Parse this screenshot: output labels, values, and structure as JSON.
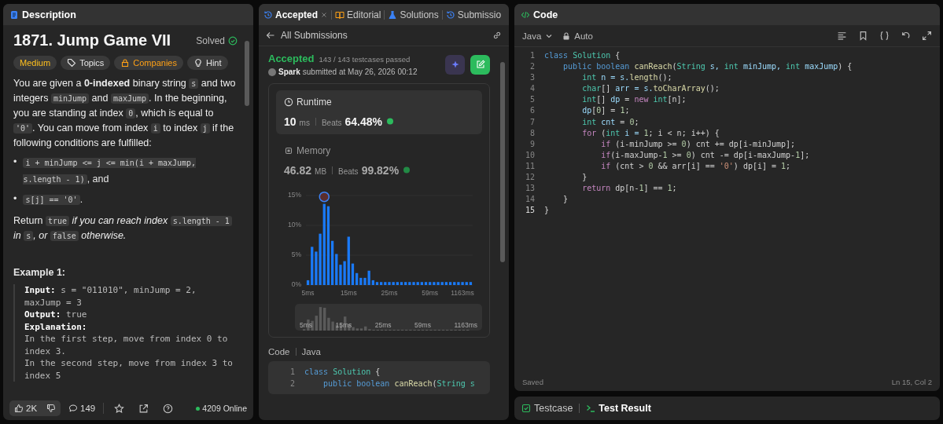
{
  "description_panel": {
    "tab": "Description",
    "title": "1871. Jump Game VII",
    "status": "Solved",
    "tags": [
      {
        "label": "Medium",
        "kind": "difficulty"
      },
      {
        "label": "Topics",
        "kind": "topics"
      },
      {
        "label": "Companies",
        "kind": "companies"
      },
      {
        "label": "Hint",
        "kind": "hint"
      }
    ],
    "paragraph_1": [
      {
        "text": "You are given a ",
        "kind": "text"
      },
      {
        "text": "0-indexed",
        "kind": "bold"
      },
      {
        "text": " binary string ",
        "kind": "text"
      },
      {
        "text": "s",
        "kind": "code"
      },
      {
        "text": " and two integers ",
        "kind": "text"
      },
      {
        "text": "minJump",
        "kind": "code"
      },
      {
        "text": " and ",
        "kind": "text"
      },
      {
        "text": "maxJump",
        "kind": "code"
      },
      {
        "text": ". In the beginning, you are standing at index ",
        "kind": "text"
      },
      {
        "text": "0",
        "kind": "code"
      },
      {
        "text": ", which is equal to ",
        "kind": "text"
      },
      {
        "text": "'0'",
        "kind": "code"
      },
      {
        "text": ". You can move from index ",
        "kind": "text"
      },
      {
        "text": "i",
        "kind": "code"
      },
      {
        "text": " to index ",
        "kind": "text"
      },
      {
        "text": "j",
        "kind": "code"
      },
      {
        "text": " if the following conditions are fulfilled:",
        "kind": "text"
      }
    ],
    "bullets": [
      {
        "marker": "•",
        "segments": [
          {
            "text": "i + minJump <= j <= min(i + maxJump, s.length - 1)",
            "kind": "code"
          },
          {
            "text": ", and",
            "kind": "text"
          }
        ]
      },
      {
        "marker": "•",
        "segments": [
          {
            "text": "s[j] == '0'",
            "kind": "code"
          },
          {
            "text": ".",
            "kind": "text"
          }
        ]
      }
    ],
    "paragraph_2": [
      {
        "text": "Return ",
        "kind": "text"
      },
      {
        "text": "true",
        "kind": "code"
      },
      {
        "text": " if you can reach index ",
        "kind": "italic"
      },
      {
        "text": "s.length - 1",
        "kind": "code"
      },
      {
        "text": " in ",
        "kind": "italic"
      },
      {
        "text": "s",
        "kind": "code"
      },
      {
        "text": ", or ",
        "kind": "italic"
      },
      {
        "text": "false",
        "kind": "code"
      },
      {
        "text": " otherwise.",
        "kind": "italic"
      }
    ],
    "example_title": "Example 1:",
    "example_lines": [
      {
        "label": "Input:",
        "value": " s = \"011010\", minJump = 2,"
      },
      {
        "value": "maxJump = 3"
      },
      {
        "label": "Output:",
        "value": " true"
      },
      {
        "label": "Explanation:"
      },
      {
        "value": "In the first step, move from index 0 to"
      },
      {
        "value": "index 3."
      },
      {
        "value": "In the second step, move from index 3 to"
      },
      {
        "value": "index 5"
      }
    ],
    "footer": {
      "likes": "2K",
      "comments": "149",
      "online": "4209 Online"
    }
  },
  "submission_panel": {
    "tabs": [
      {
        "label": "Accepted",
        "kind": "accepted",
        "selected": true
      },
      {
        "label": "Editorial",
        "kind": "editorial",
        "selected": false
      },
      {
        "label": "Solutions",
        "kind": "solutions",
        "selected": false
      },
      {
        "label": "Submissio",
        "kind": "submissions",
        "selected": false
      }
    ],
    "back_link": "All Submissions",
    "result": "Accepted",
    "testcases": "143 / 143 testcases passed",
    "user": "Spark",
    "submitted": "submitted at May 26, 2026 00:12",
    "runtime": {
      "title": "Runtime",
      "value": "10",
      "unit": "ms",
      "beats_label": "Beats",
      "beats": "64.48%"
    },
    "memory": {
      "title": "Memory",
      "value": "46.82",
      "unit": "MB",
      "beats_label": "Beats",
      "beats": "99.82%"
    },
    "chart_data": {
      "type": "bar",
      "ylim": [
        0,
        15
      ],
      "yticks": [
        {
          "value": 0,
          "label": "0%"
        },
        {
          "value": 5,
          "label": "5%"
        },
        {
          "value": 10,
          "label": "10%"
        },
        {
          "value": 15,
          "label": "15%"
        }
      ],
      "categories": [
        "5ms",
        null,
        null,
        null,
        null,
        null,
        null,
        null,
        null,
        null,
        "15ms",
        null,
        null,
        null,
        null,
        null,
        null,
        null,
        null,
        null,
        "25ms",
        null,
        null,
        null,
        null,
        null,
        null,
        null,
        null,
        null,
        "59ms",
        null,
        null,
        null,
        null,
        null,
        null,
        null,
        "1163ms",
        null,
        null
      ],
      "values": [
        0.8,
        6.4,
        5.6,
        8.6,
        13.6,
        13.2,
        7.4,
        5.2,
        3.4,
        4.0,
        8.1,
        3.6,
        2.0,
        1.2,
        1.2,
        2.4,
        0.8,
        0.5,
        0.5,
        0.5,
        0.5,
        0.5,
        0.5,
        0.5,
        0.5,
        0.5,
        0.5,
        0.5,
        0.5,
        0.5,
        0.5,
        0.5,
        0.5,
        0.5,
        0.5,
        0.5,
        0.5,
        0.5,
        0.5,
        0.5,
        0.5
      ]
    },
    "overview_labels": [
      "5ms",
      "15ms",
      "25ms",
      "59ms",
      "1163ms"
    ],
    "code_title": "Code",
    "code_language": "Java",
    "code_lines": [
      {
        "n": "1",
        "tokens": [
          {
            "text": "class ",
            "kind": "decl"
          },
          {
            "text": "Solution",
            "kind": "type"
          },
          {
            "text": " {",
            "kind": "p"
          }
        ]
      },
      {
        "n": "2",
        "tokens": [
          {
            "text": "    public boolean ",
            "kind": "decl"
          },
          {
            "text": "canReach",
            "kind": "fn"
          },
          {
            "text": "(",
            "kind": "p"
          },
          {
            "text": "String s",
            "kind": "type"
          }
        ]
      }
    ]
  },
  "code_panel": {
    "title": "Code",
    "language": "Java",
    "mode": "Auto",
    "lines": [
      {
        "n": "1",
        "tokens": [
          {
            "text": "class ",
            "kind": "decl"
          },
          {
            "text": "Solution",
            "kind": "type"
          },
          {
            "text": " {",
            "kind": "p"
          }
        ]
      },
      {
        "n": "2",
        "tokens": [
          {
            "text": "    public boolean ",
            "kind": "decl"
          },
          {
            "text": "canReach",
            "kind": "fn"
          },
          {
            "text": "(",
            "kind": "p"
          },
          {
            "text": "String",
            "kind": "type"
          },
          {
            "text": " s, ",
            "kind": "var"
          },
          {
            "text": "int",
            "kind": "type"
          },
          {
            "text": " minJump, ",
            "kind": "var"
          },
          {
            "text": "int",
            "kind": "type"
          },
          {
            "text": " maxJump",
            "kind": "var"
          },
          {
            "text": ") {",
            "kind": "p"
          }
        ]
      },
      {
        "n": "3",
        "tokens": [
          {
            "text": "        int",
            "kind": "type"
          },
          {
            "text": " n = s.",
            "kind": "var"
          },
          {
            "text": "length",
            "kind": "fn"
          },
          {
            "text": "();",
            "kind": "p"
          }
        ]
      },
      {
        "n": "4",
        "tokens": [
          {
            "text": "        char",
            "kind": "type"
          },
          {
            "text": "[] ",
            "kind": "p"
          },
          {
            "text": "arr",
            "kind": "var"
          },
          {
            "text": " = s.",
            "kind": "var"
          },
          {
            "text": "toCharArray",
            "kind": "fn"
          },
          {
            "text": "();",
            "kind": "p"
          }
        ]
      },
      {
        "n": "5",
        "tokens": [
          {
            "text": "        int",
            "kind": "type"
          },
          {
            "text": "[] ",
            "kind": "p"
          },
          {
            "text": "dp",
            "kind": "var"
          },
          {
            "text": " = ",
            "kind": "p"
          },
          {
            "text": "new ",
            "kind": "ctrl"
          },
          {
            "text": "int",
            "kind": "type"
          },
          {
            "text": "[n];",
            "kind": "p"
          }
        ]
      },
      {
        "n": "6",
        "tokens": [
          {
            "text": "        dp",
            "kind": "var"
          },
          {
            "text": "[",
            "kind": "p"
          },
          {
            "text": "0",
            "kind": "num"
          },
          {
            "text": "] = ",
            "kind": "p"
          },
          {
            "text": "1",
            "kind": "num"
          },
          {
            "text": ";",
            "kind": "p"
          }
        ]
      },
      {
        "n": "7",
        "tokens": [
          {
            "text": "        int",
            "kind": "type"
          },
          {
            "text": " cnt",
            "kind": "var"
          },
          {
            "text": " = ",
            "kind": "p"
          },
          {
            "text": "0",
            "kind": "num"
          },
          {
            "text": ";",
            "kind": "p"
          }
        ]
      },
      {
        "n": "8",
        "tokens": [
          {
            "text": "        for ",
            "kind": "ctrl"
          },
          {
            "text": "(",
            "kind": "p"
          },
          {
            "text": "int",
            "kind": "type"
          },
          {
            "text": " i = ",
            "kind": "var"
          },
          {
            "text": "1",
            "kind": "num"
          },
          {
            "text": "; i < n; i++) {",
            "kind": "p"
          }
        ]
      },
      {
        "n": "9",
        "tokens": [
          {
            "text": "            if ",
            "kind": "ctrl"
          },
          {
            "text": "(i-minJump >= ",
            "kind": "p"
          },
          {
            "text": "0",
            "kind": "num"
          },
          {
            "text": ") cnt += dp[i-minJump];",
            "kind": "p"
          }
        ]
      },
      {
        "n": "10",
        "tokens": [
          {
            "text": "            if",
            "kind": "ctrl"
          },
          {
            "text": "(i-maxJump-",
            "kind": "p"
          },
          {
            "text": "1",
            "kind": "num"
          },
          {
            "text": " >= ",
            "kind": "p"
          },
          {
            "text": "0",
            "kind": "num"
          },
          {
            "text": ") cnt -= dp[i-maxJump-",
            "kind": "p"
          },
          {
            "text": "1",
            "kind": "num"
          },
          {
            "text": "];",
            "kind": "p"
          }
        ]
      },
      {
        "n": "11",
        "tokens": [
          {
            "text": "            if ",
            "kind": "ctrl"
          },
          {
            "text": "(cnt > ",
            "kind": "p"
          },
          {
            "text": "0",
            "kind": "num"
          },
          {
            "text": " && arr[i] == ",
            "kind": "p"
          },
          {
            "text": "'0'",
            "kind": "str"
          },
          {
            "text": ") dp[i] = ",
            "kind": "p"
          },
          {
            "text": "1",
            "kind": "num"
          },
          {
            "text": ";",
            "kind": "p"
          }
        ]
      },
      {
        "n": "12",
        "tokens": [
          {
            "text": "        }",
            "kind": "p"
          }
        ]
      },
      {
        "n": "13",
        "tokens": [
          {
            "text": "        return ",
            "kind": "ctrl"
          },
          {
            "text": "dp[n-",
            "kind": "p"
          },
          {
            "text": "1",
            "kind": "num"
          },
          {
            "text": "] == ",
            "kind": "p"
          },
          {
            "text": "1",
            "kind": "num"
          },
          {
            "text": ";",
            "kind": "p"
          }
        ]
      },
      {
        "n": "14",
        "tokens": [
          {
            "text": "    }",
            "kind": "p"
          }
        ]
      },
      {
        "n": "15",
        "tokens": [
          {
            "text": "}",
            "kind": "p"
          }
        ]
      }
    ],
    "status": "Saved",
    "cursor": "Ln 15, Col 2"
  },
  "bottom_panel": {
    "tabs": [
      {
        "label": "Testcase",
        "kind": "testcase",
        "selected": false
      },
      {
        "label": "Test Result",
        "kind": "result",
        "selected": true
      }
    ]
  }
}
